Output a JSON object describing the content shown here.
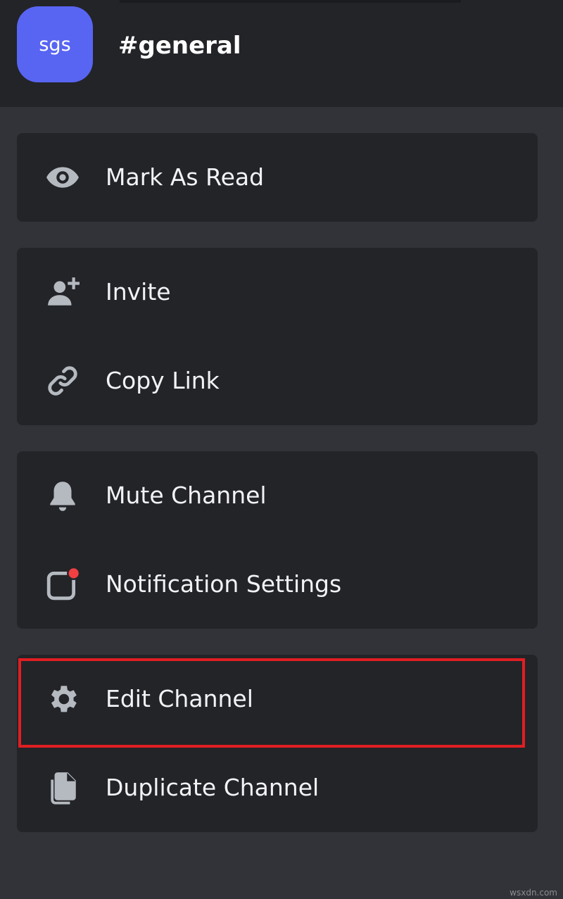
{
  "header": {
    "server_avatar_text": "sgs",
    "channel_name": "#general",
    "avatar_color": "#5865f2"
  },
  "menu": {
    "groups": [
      {
        "items": [
          {
            "label": "Mark As Read",
            "icon": "eye-icon"
          }
        ]
      },
      {
        "items": [
          {
            "label": "Invite",
            "icon": "add-user-icon"
          },
          {
            "label": "Copy Link",
            "icon": "link-icon"
          }
        ]
      },
      {
        "items": [
          {
            "label": "Mute Channel",
            "icon": "bell-icon"
          },
          {
            "label": "Notification Settings",
            "icon": "notification-settings-icon"
          }
        ]
      },
      {
        "items": [
          {
            "label": "Edit Channel",
            "icon": "gear-icon",
            "highlighted": true
          },
          {
            "label": "Duplicate Channel",
            "icon": "duplicate-icon"
          }
        ]
      }
    ]
  },
  "colors": {
    "background": "#313338",
    "panel": "#232428",
    "highlight_border": "#e01e22",
    "notification_dot": "#f23f42"
  },
  "watermark": "wsxdn.com"
}
